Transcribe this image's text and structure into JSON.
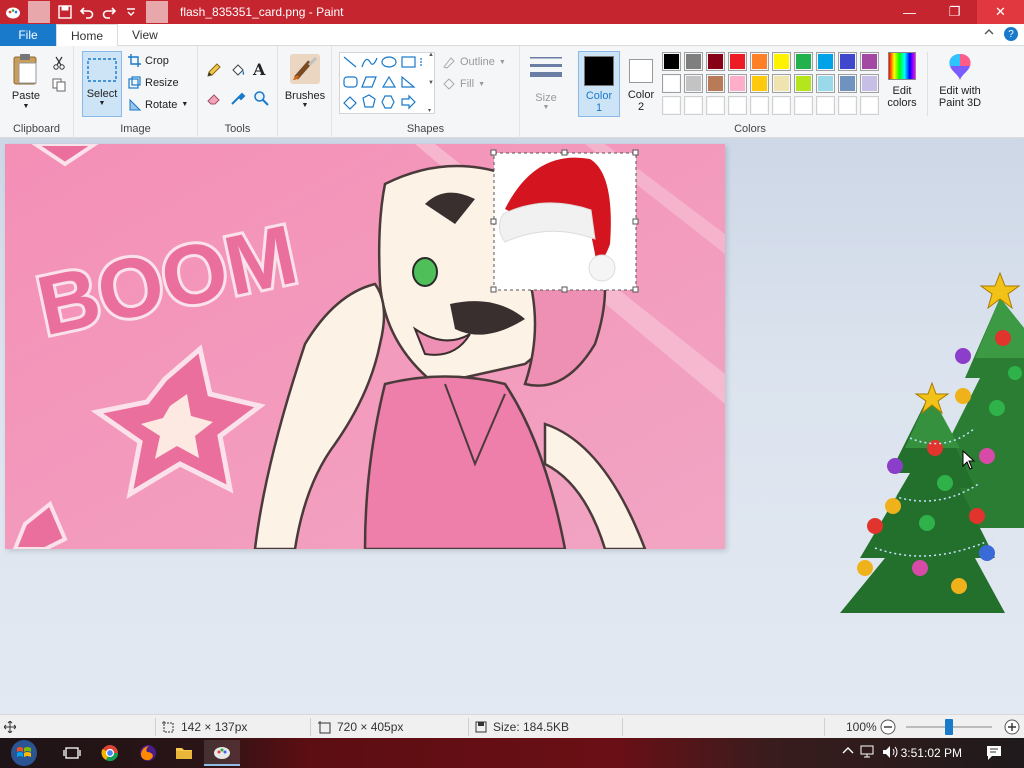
{
  "window": {
    "title": "flash_835351_card.png - Paint",
    "minimize_glyph": "—",
    "maximize_glyph": "❐",
    "close_glyph": "✕"
  },
  "tabs": [
    {
      "label": "File"
    },
    {
      "label": "Home"
    },
    {
      "label": "View"
    }
  ],
  "ribbon": {
    "clipboard": {
      "group_label": "Clipboard",
      "paste_label": "Paste"
    },
    "image": {
      "group_label": "Image",
      "select_label": "Select",
      "crop_label": "Crop",
      "resize_label": "Resize",
      "rotate_label": "Rotate"
    },
    "tools": {
      "group_label": "Tools"
    },
    "brushes": {
      "label": "Brushes"
    },
    "shapes": {
      "group_label": "Shapes",
      "outline_label": "Outline",
      "fill_label": "Fill"
    },
    "size": {
      "label": "Size"
    },
    "colors": {
      "group_label": "Colors",
      "color1_label": "Color",
      "color1_num": "1",
      "color2_label": "Color",
      "color2_num": "2",
      "color1_value": "#000000",
      "color2_value": "#ffffff",
      "edit_colors_line1": "Edit",
      "edit_colors_line2": "colors",
      "paint3d_line1": "Edit with",
      "paint3d_line2": "Paint 3D",
      "palette_row1": [
        "#000000",
        "#7f7f7f",
        "#880015",
        "#ed1c24",
        "#ff7f27",
        "#fff200",
        "#22b14c",
        "#00a2e8",
        "#3f48cc",
        "#a349a4"
      ],
      "palette_row2": [
        "#ffffff",
        "#c3c3c3",
        "#b97a57",
        "#ffaec9",
        "#ffc90e",
        "#efe4b0",
        "#b5e61d",
        "#99d9ea",
        "#7092be",
        "#c8bfe7"
      ],
      "palette_row3": [
        "#ffffff",
        "#ffffff",
        "#ffffff",
        "#ffffff",
        "#ffffff",
        "#ffffff",
        "#ffffff",
        "#ffffff",
        "#ffffff",
        "#ffffff"
      ]
    }
  },
  "canvas": {
    "boom_text": "BOOM"
  },
  "statusbar": {
    "selection_size": "142 × 137px",
    "image_size": "720 × 405px",
    "file_size": "Size: 184.5KB",
    "zoom": "100%",
    "zoom_level": 0.5
  },
  "taskbar": {
    "time": "3:51:02 PM"
  }
}
